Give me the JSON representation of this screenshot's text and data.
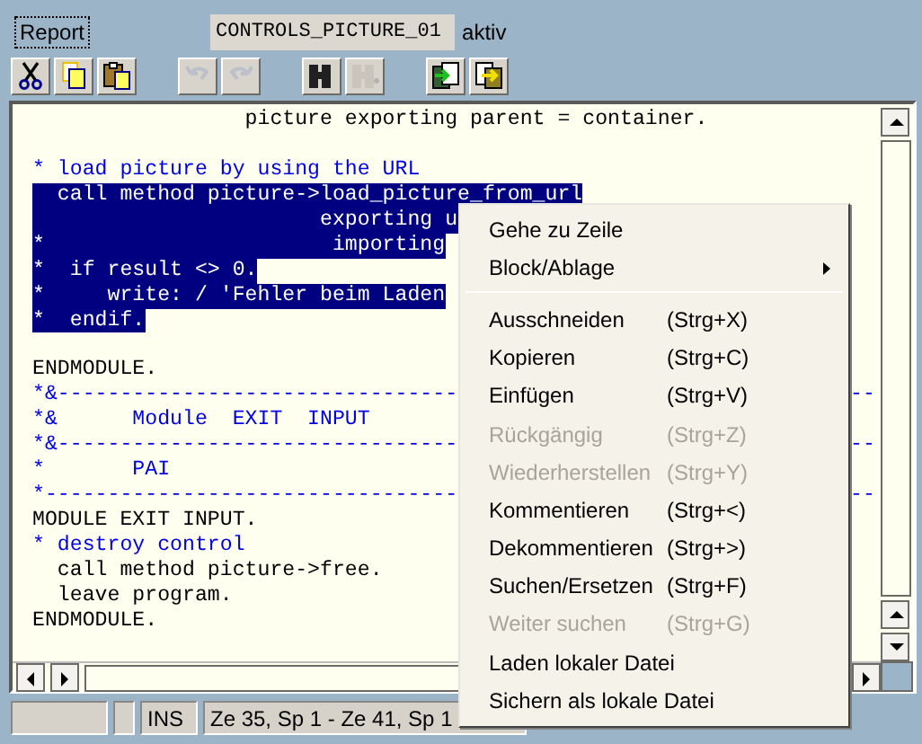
{
  "header": {
    "label": "Report",
    "field_value": "CONTROLS_PICTURE_01",
    "status": "aktiv"
  },
  "toolbar": [
    [
      {
        "kind": "cut",
        "disabled": false
      },
      {
        "kind": "copy",
        "disabled": false
      },
      {
        "kind": "paste",
        "disabled": false
      }
    ],
    [
      {
        "kind": "undo",
        "disabled": true
      },
      {
        "kind": "redo",
        "disabled": true
      }
    ],
    [
      {
        "kind": "find",
        "disabled": false
      },
      {
        "kind": "find_next",
        "disabled": true
      }
    ],
    [
      {
        "kind": "upload",
        "disabled": false
      },
      {
        "kind": "download",
        "disabled": false
      }
    ]
  ],
  "editor": {
    "lines": [
      {
        "text": "                 picture exporting parent = container.",
        "comment": false,
        "selected": false
      },
      {
        "selected": false
      },
      {
        "text": "* load picture by using the URL",
        "comment": true,
        "selected": false
      },
      {
        "text": "  call method picture->load_picture_from_url",
        "comment": false,
        "selected": true
      },
      {
        "text": "                       exporting u",
        "comment": false,
        "selected": true
      },
      {
        "text": "*                       importing",
        "comment": false,
        "selected": true
      },
      {
        "text": "*  if result <> 0.",
        "comment": false,
        "selected": true
      },
      {
        "text": "*     write: / 'Fehler beim Laden",
        "comment": false,
        "selected": true
      },
      {
        "text": "*  endif.",
        "comment": false,
        "selected": true
      },
      {
        "selected": false
      },
      {
        "text": "ENDMODULE.",
        "comment": false,
        "selected": false
      },
      {
        "text": "*&--------------------------------",
        "tail": "--",
        "comment": true,
        "selected": false
      },
      {
        "text": "*&      Module  EXIT  INPUT",
        "comment": true,
        "selected": false
      },
      {
        "text": "*&--------------------------------",
        "tail": "--",
        "comment": true,
        "selected": false
      },
      {
        "text": "*       PAI",
        "comment": true,
        "selected": false
      },
      {
        "text": "*---------------------------------",
        "tail": "--",
        "comment": true,
        "selected": false
      },
      {
        "text": "MODULE EXIT INPUT.",
        "comment": false,
        "selected": false
      },
      {
        "text": "* destroy control",
        "comment": true,
        "selected": false
      },
      {
        "text": "  call method picture->free.",
        "comment": false,
        "selected": false
      },
      {
        "text": "  leave program.",
        "comment": false,
        "selected": false
      },
      {
        "text": "ENDMODULE.",
        "comment": false,
        "selected": false
      }
    ]
  },
  "status_bar": {
    "mode": "INS",
    "position": "Ze 35, Sp 1 - Ze 41, Sp 1"
  },
  "context_menu": {
    "items": [
      {
        "kind": "item",
        "label": "Gehe zu Zeile",
        "disabled": false
      },
      {
        "kind": "submenu",
        "label": "Block/Ablage",
        "disabled": false
      },
      {
        "kind": "separator"
      },
      {
        "kind": "item",
        "label": "Ausschneiden",
        "shortcut": "(Strg+X)",
        "disabled": false
      },
      {
        "kind": "item",
        "label": "Kopieren",
        "shortcut": "(Strg+C)",
        "disabled": false
      },
      {
        "kind": "item",
        "label": "Einfügen",
        "shortcut": "(Strg+V)",
        "disabled": false
      },
      {
        "kind": "item",
        "label": "Rückgängig",
        "shortcut": "(Strg+Z)",
        "disabled": true
      },
      {
        "kind": "item",
        "label": "Wiederherstellen",
        "shortcut": "(Strg+Y)",
        "disabled": true
      },
      {
        "kind": "item",
        "label": "Kommentieren",
        "shortcut": "(Strg+<)",
        "disabled": false
      },
      {
        "kind": "item",
        "label": "Dekommentieren",
        "shortcut": "(Strg+>)",
        "disabled": false
      },
      {
        "kind": "item",
        "label": "Suchen/Ersetzen",
        "shortcut": "(Strg+F)",
        "disabled": false
      },
      {
        "kind": "item",
        "label": "Weiter suchen",
        "shortcut": "(Strg+G)",
        "disabled": true
      },
      {
        "kind": "item",
        "label": "Laden lokaler Datei",
        "disabled": false
      },
      {
        "kind": "item",
        "label": "Sichern als lokale Datei",
        "disabled": false
      }
    ]
  }
}
